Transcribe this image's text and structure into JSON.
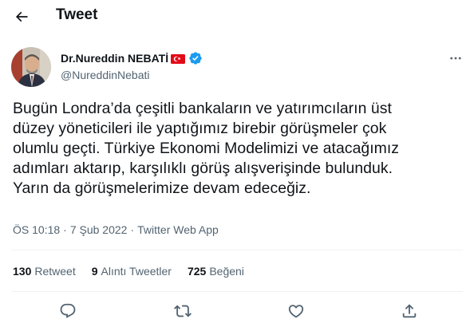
{
  "header": {
    "title": "Tweet",
    "back_icon": "arrow-left-icon"
  },
  "author": {
    "name": "Dr.Nureddin NEBATİ",
    "handle": "@NureddinNebati",
    "flag_icon": "turkey-flag-icon",
    "verified_icon": "verified-badge-icon",
    "verified_color": "#1d9bf0",
    "more_icon": "more-horizontal-icon"
  },
  "tweet": {
    "text": "Bugün Londra’da çeşitli bankaların ve yatırımcıların üst\ndüzey yöneticileri ile yaptığımız birebir görüşmeler çok\nolumlu geçti. Türkiye Ekonomi Modelimizi ve atacağımız\nadımları aktarıp, karşılıklı görüş alışverişinde bulunduk.\nYarın da görüşmelerimize devam edeceğiz."
  },
  "meta": {
    "time": "ÖS 10:18",
    "separator": "·",
    "date": "7 Şub 2022",
    "source": "Twitter Web App"
  },
  "stats": [
    {
      "count": "130",
      "label": "Retweet"
    },
    {
      "count": "9",
      "label": "Alıntı Tweetler"
    },
    {
      "count": "725",
      "label": "Beğeni"
    }
  ],
  "actions": {
    "reply_icon": "reply-icon",
    "retweet_icon": "retweet-icon",
    "like_icon": "heart-icon",
    "share_icon": "share-icon"
  },
  "colors": {
    "text": "#0f1419",
    "secondary": "#536471",
    "divider": "#eff3f4",
    "flag_red": "#e30a17"
  }
}
